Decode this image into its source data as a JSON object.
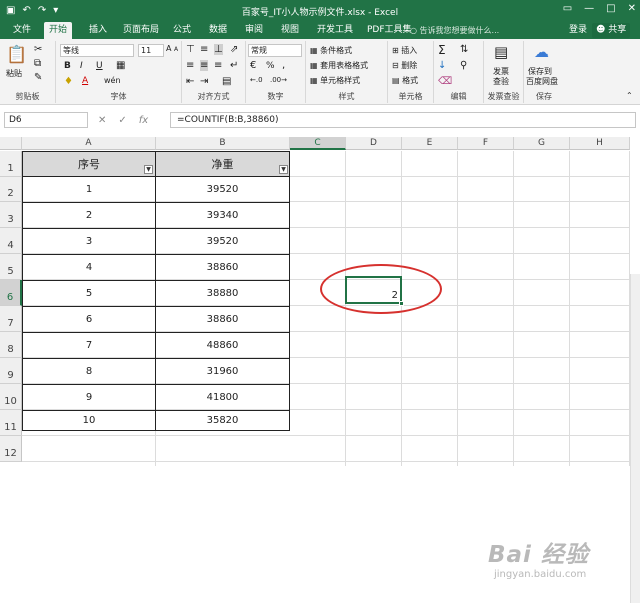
{
  "titlebar": {
    "title": "百家号_IT小人物示例文件.xlsx - Excel",
    "save_icon": "save-icon",
    "undo_icon": "undo-icon",
    "redo_icon": "redo-icon"
  },
  "tabs": [
    {
      "label": "文件"
    },
    {
      "label": "开始",
      "active": true
    },
    {
      "label": "插入"
    },
    {
      "label": "页面布局"
    },
    {
      "label": "公式"
    },
    {
      "label": "数据"
    },
    {
      "label": "审阅"
    },
    {
      "label": "视图"
    },
    {
      "label": "开发工具"
    },
    {
      "label": "PDF工具集"
    }
  ],
  "tell_me": "告诉我您想要做什么...",
  "login": "登录",
  "share": "共享",
  "ribbon": {
    "clipboard": {
      "paste": "粘贴",
      "label": "剪贴板"
    },
    "font": {
      "name": "等线",
      "size": "11",
      "label": "字体",
      "bold": "B",
      "italic": "I",
      "underline": "U",
      "grow": "A",
      "shrink": "A",
      "color": "A"
    },
    "align": {
      "label": "对齐方式"
    },
    "number": {
      "format": "常规",
      "label": "数字",
      "pct": "%",
      "comma": ","
    },
    "styles": {
      "cond": "条件格式",
      "table": "套用表格格式",
      "cell": "单元格样式",
      "label": "样式"
    },
    "cells": {
      "insert": "插入",
      "delete": "删除",
      "format": "格式",
      "label": "单元格"
    },
    "editing": {
      "label": "编辑",
      "sum": "Σ"
    },
    "invoice": {
      "line1": "发票",
      "line2": "查验",
      "label": "发票查验"
    },
    "save": {
      "line1": "保存到",
      "line2": "百度网盘",
      "label": "保存"
    }
  },
  "formula_bar": {
    "name_box": "D6",
    "formula": "=COUNTIF(B:B,38860)",
    "fx": "fx"
  },
  "columns": [
    "A",
    "B",
    "C",
    "D",
    "E",
    "F",
    "G",
    "H"
  ],
  "rows": [
    "1",
    "2",
    "3",
    "4",
    "5",
    "6",
    "7",
    "8",
    "9",
    "10",
    "11",
    "12"
  ],
  "table": {
    "headers": [
      "序号",
      "净重"
    ],
    "rows": [
      [
        "1",
        "39520"
      ],
      [
        "2",
        "39340"
      ],
      [
        "3",
        "39520"
      ],
      [
        "4",
        "38860"
      ],
      [
        "5",
        "38880"
      ],
      [
        "6",
        "38860"
      ],
      [
        "7",
        "48860"
      ],
      [
        "8",
        "31960"
      ],
      [
        "9",
        "41800"
      ],
      [
        "10",
        "35820"
      ]
    ]
  },
  "active_cell": {
    "ref": "D6",
    "value": "2"
  },
  "watermark": {
    "logo": "Bai 经验",
    "url": "jingyan.baidu.com"
  }
}
